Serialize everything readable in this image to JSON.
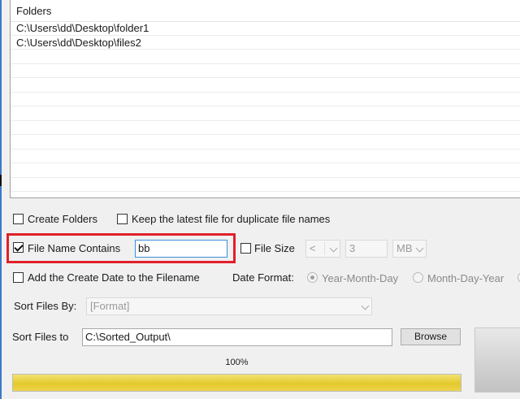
{
  "folders": {
    "header": "Folders",
    "rows": [
      "C:\\Users\\dd\\Desktop\\folder1",
      "C:\\Users\\dd\\Desktop\\files2"
    ]
  },
  "options": {
    "create_folders": {
      "label": "Create Folders",
      "checked": false
    },
    "keep_latest": {
      "label": "Keep the latest file for duplicate file names",
      "checked": false
    },
    "file_name_contains": {
      "label": "File Name Contains",
      "checked": true,
      "value": "bb"
    },
    "file_size": {
      "label": "File Size",
      "checked": false,
      "operator": "<",
      "amount": "3",
      "unit": "MB"
    },
    "add_create_date": {
      "label": "Add the Create Date to the Filename",
      "checked": false
    }
  },
  "date_format": {
    "label": "Date Format:",
    "options": [
      "Year-Month-Day",
      "Month-Day-Year"
    ],
    "selected": "Year-Month-Day"
  },
  "sort_by": {
    "label": "Sort Files By:",
    "value": "[Format]"
  },
  "sort_to": {
    "label": "Sort Files to",
    "value": "C:\\Sorted_Output\\",
    "browse_label": "Browse"
  },
  "progress": {
    "label": "100%",
    "fraction": 1.0
  },
  "colors": {
    "highlight": "#e0202a",
    "progress": "#e3c92c"
  }
}
